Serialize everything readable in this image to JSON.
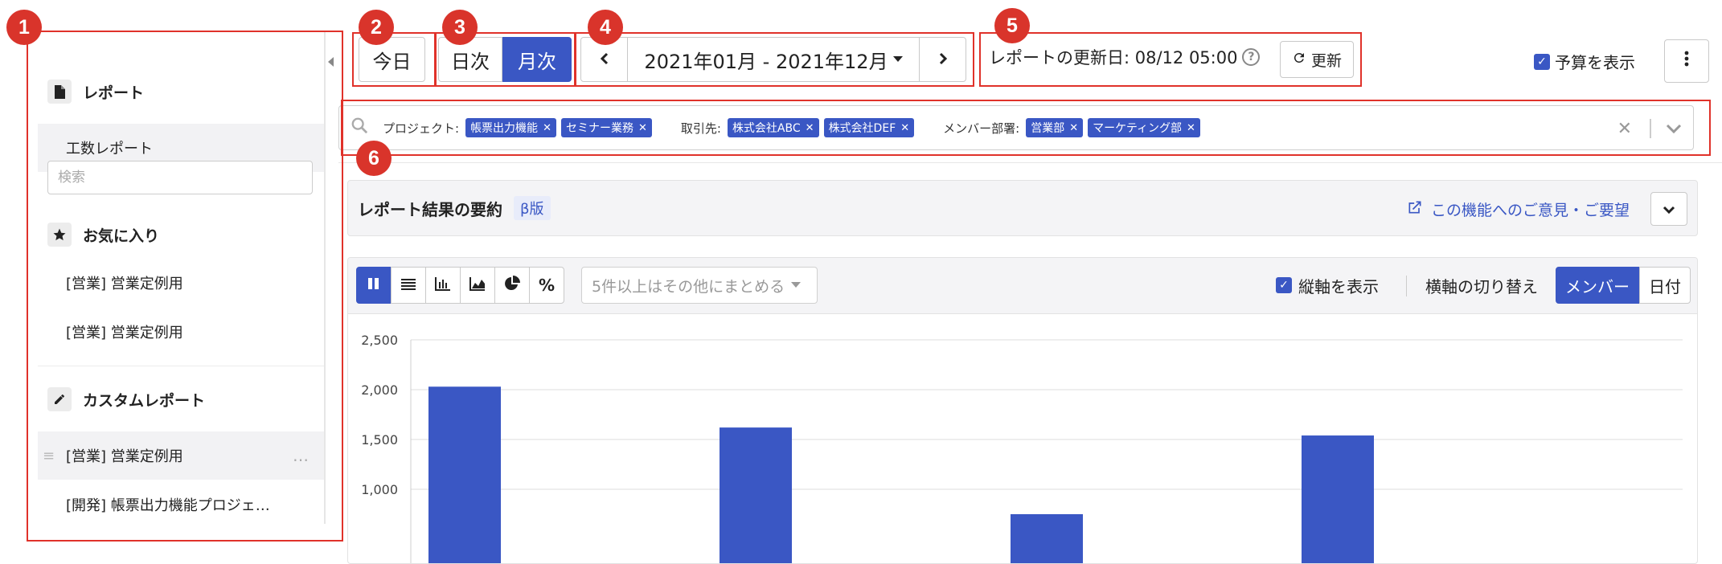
{
  "annotations": [
    "1",
    "2",
    "3",
    "4",
    "5",
    "6"
  ],
  "sidebar": {
    "section_reports": "レポート",
    "item_manhour": "工数レポート",
    "search_placeholder": "検索",
    "section_favorites": "お気に入り",
    "fav_items": [
      "[営業] 営業定例用",
      "[営業] 営業定例用"
    ],
    "section_custom": "カスタムレポート",
    "custom_items": [
      "[営業] 営業定例用",
      "[開発] 帳票出力機能プロジェ…"
    ],
    "grip": "≡",
    "dots": "…"
  },
  "toolbar": {
    "today": "今日",
    "daily": "日次",
    "monthly": "月次",
    "range": "2021年01月 - 2021年12月",
    "updated_label": "レポートの更新日: 08/12 05:00",
    "refresh": "更新",
    "show_budget": "予算を表示"
  },
  "filters": {
    "project_label": "プロジェクト:",
    "project_chips": [
      "帳票出力機能",
      "セミナー業務"
    ],
    "client_label": "取引先:",
    "client_chips": [
      "株式会社ABC",
      "株式会社DEF"
    ],
    "dept_label": "メンバー部署:",
    "dept_chips": [
      "営業部",
      "マーケティング部"
    ]
  },
  "summary": {
    "title": "レポート結果の要約",
    "beta": "β版",
    "feedback": "この機能へのご意見・ご要望"
  },
  "chart_toolbar": {
    "group_select": "5件以上はその他にまとめる",
    "show_vaxis": "縦軸を表示",
    "switch_haxis": "横軸の切り替え",
    "member": "メンバー",
    "date": "日付"
  },
  "colors": {
    "accent": "#3a57c4",
    "annotation": "#d9342b"
  },
  "chart_data": {
    "type": "bar",
    "values": [
      2030,
      1620,
      750,
      1540
    ],
    "y_ticks": [
      "2,500",
      "2,000",
      "1,500",
      "1,000"
    ],
    "ylim": [
      700,
      2500
    ],
    "grid": true
  }
}
